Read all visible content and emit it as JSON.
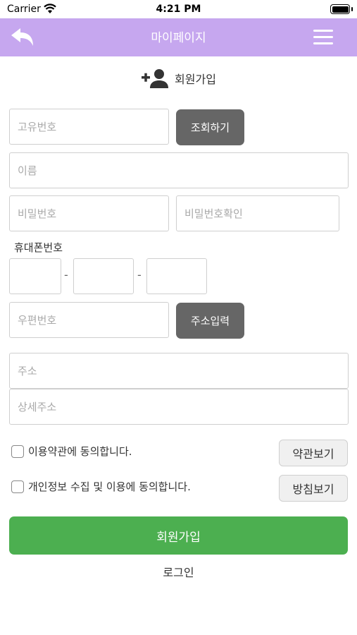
{
  "status_bar": {
    "carrier": "Carrier",
    "time": "4:21 PM"
  },
  "header": {
    "title": "마이페이지",
    "back_icon": "back-arrow-icon",
    "menu_icon": "hamburger-menu-icon"
  },
  "section": {
    "title": "회원가입",
    "icon": "add-user-icon"
  },
  "form": {
    "unique_id": {
      "placeholder": "고유번호",
      "value": ""
    },
    "lookup_button": "조회하기",
    "name": {
      "placeholder": "이름",
      "value": ""
    },
    "password": {
      "placeholder": "비밀번호",
      "value": ""
    },
    "password_confirm": {
      "placeholder": "비밀번호확인",
      "value": ""
    },
    "phone_label": "휴대폰번호",
    "phone_separator": "-",
    "phone_parts": [
      "",
      "",
      ""
    ],
    "postcode": {
      "placeholder": "우편번호",
      "value": ""
    },
    "address_button": "주소입력",
    "address": {
      "placeholder": "주소",
      "value": ""
    },
    "address_detail": {
      "placeholder": "상세주소",
      "value": ""
    }
  },
  "agreements": [
    {
      "label": "이용약관에 동의합니다.",
      "button": "약관보기",
      "checked": false
    },
    {
      "label": "개인정보 수집 및 이용에 동의합니다.",
      "button": "방침보기",
      "checked": false
    }
  ],
  "submit_button": "회원가입",
  "login_link": "로그인",
  "colors": {
    "header": "#c6a7ef",
    "primary": "#4caf50",
    "dark_button": "#666666"
  }
}
